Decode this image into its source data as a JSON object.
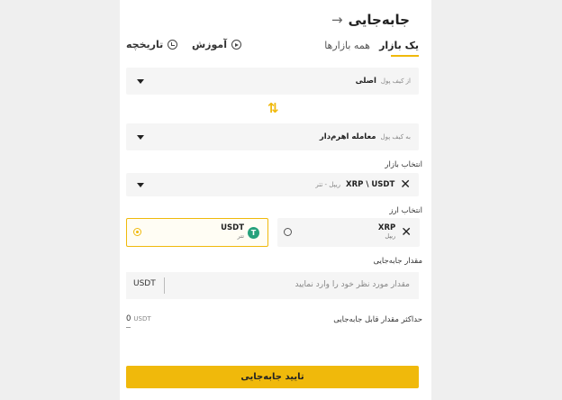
{
  "header": {
    "title": "جابه‌جایی"
  },
  "tabs": [
    {
      "label": "یک بازار",
      "active": true
    },
    {
      "label": "همه بازارها",
      "active": false
    }
  ],
  "links": {
    "tutorial": "آموزش",
    "history": "تاریخچه"
  },
  "from_wallet": {
    "label": "از کیف پول",
    "value": "اصلی"
  },
  "to_wallet": {
    "label": "به کیف پول",
    "value": "معامله اهرم‌دار"
  },
  "market": {
    "section_label": "انتخاب بازار",
    "pair_code": "XRP \\ USDT",
    "pair_name": "ریپل - تتر"
  },
  "currency": {
    "section_label": "انتخاب ارز",
    "options": [
      {
        "code": "USDT",
        "name": "تتر",
        "selected": true
      },
      {
        "code": "XRP",
        "name": "ریپل",
        "selected": false
      }
    ]
  },
  "amount": {
    "section_label": "مقدار جابه‌جایی",
    "placeholder": "مقدار مورد نظر خود را وارد نمایید",
    "unit": "USDT"
  },
  "max_transfer": {
    "label": "حداکثر مقدار قابل جابه‌جایی",
    "value": "0",
    "unit": "USDT"
  },
  "submit": {
    "label": "تایید جابه‌جایی"
  },
  "colors": {
    "accent": "#f0b90b",
    "field_bg": "#f5f5f5",
    "tether": "#26a17b"
  }
}
